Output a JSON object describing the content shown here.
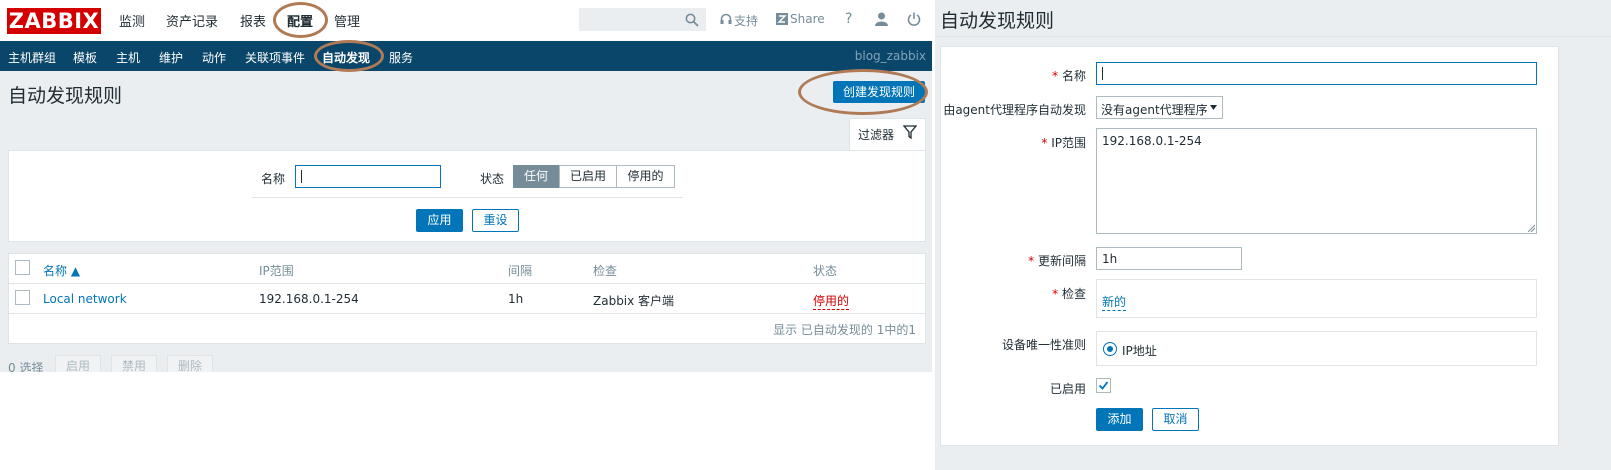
{
  "app": {
    "logo": "ZABBIX",
    "top_menu": [
      "监测",
      "资产记录",
      "报表",
      "配置",
      "管理"
    ],
    "support_label": "支持",
    "share_label": "Share",
    "help_label": "?",
    "sub_menu": [
      "主机群组",
      "模板",
      "主机",
      "维护",
      "动作",
      "关联项事件",
      "自动发现",
      "服务"
    ],
    "username": "blog_zabbix"
  },
  "list_page": {
    "title": "自动发现规则",
    "create_button": "创建发现规则",
    "filter_tab": "过滤器",
    "filter": {
      "name_label": "名称",
      "name_value": "",
      "status_label": "状态",
      "status_options": [
        "任何",
        "已启用",
        "停用的"
      ],
      "status_selected": "任何",
      "apply_button": "应用",
      "reset_button": "重设"
    },
    "table": {
      "headers": [
        "名称 ▲",
        "IP范围",
        "间隔",
        "检查",
        "状态"
      ],
      "rows": [
        {
          "name": "Local network",
          "ip_range": "192.168.0.1-254",
          "interval": "1h",
          "checks": "Zabbix 客户端",
          "status": "停用的"
        }
      ],
      "footer": "显示 已自动发现的 1中的1"
    },
    "bulk": {
      "selected": "0 选择",
      "buttons": [
        "启用",
        "禁用",
        "删除"
      ]
    }
  },
  "form_page": {
    "title": "自动发现规则",
    "fields": {
      "name_label": "名称",
      "name_value": "",
      "proxy_label": "由agent代理程序自动发现",
      "proxy_value": "没有agent代理程序",
      "ip_label": "IP范围",
      "ip_value": "192.168.0.1-254",
      "interval_label": "更新间隔",
      "interval_value": "1h",
      "checks_label": "检查",
      "checks_link": "新的",
      "uniqueness_label": "设备唯一性准则",
      "uniqueness_value": "IP地址",
      "enabled_label": "已启用",
      "enabled": true
    },
    "add_button": "添加",
    "cancel_button": "取消"
  },
  "colors": {
    "brand_red": "#d40000",
    "nav_bg": "#0a466a",
    "accent_blue": "#0275b8",
    "highlight_ring": "#b07a55",
    "disabled_status": "#d40000"
  }
}
